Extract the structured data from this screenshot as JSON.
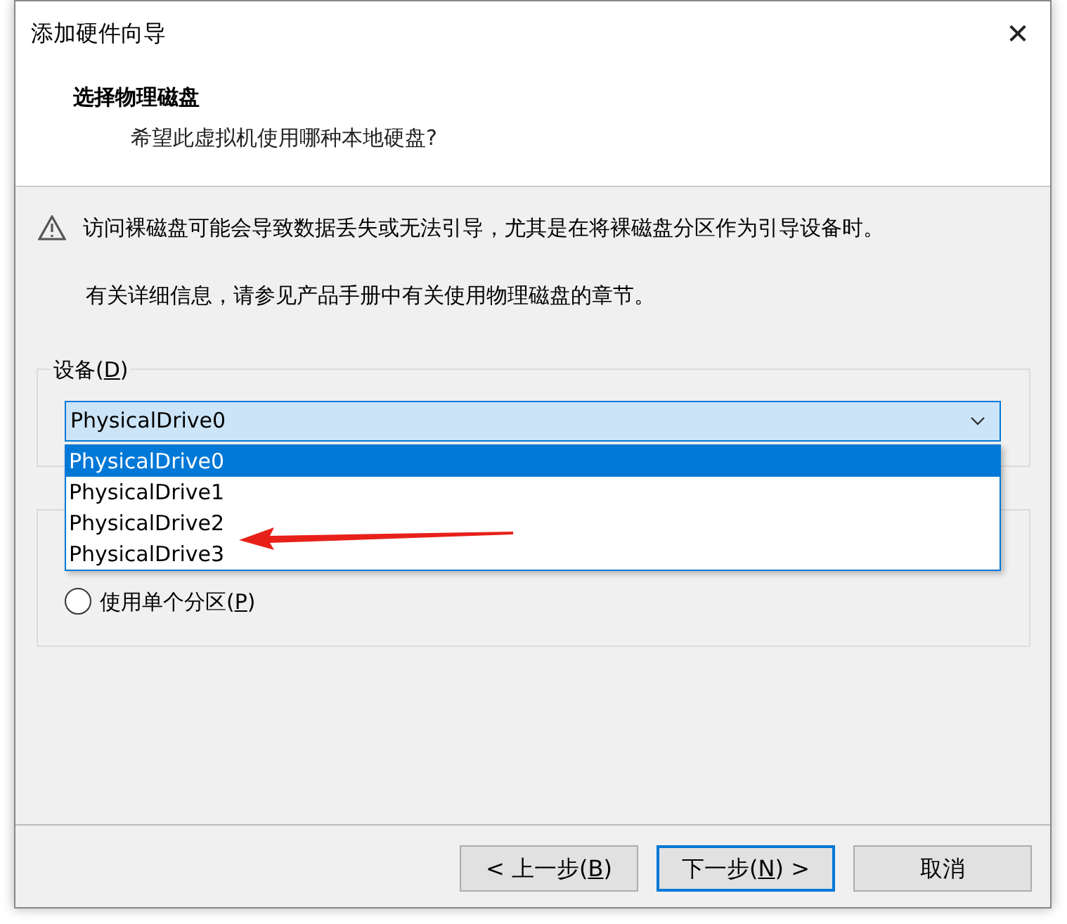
{
  "window": {
    "title": "添加硬件向导",
    "close": "✕"
  },
  "header": {
    "title": "选择物理磁盘",
    "subtitle": "希望此虚拟机使用哪种本地硬盘?"
  },
  "warning": {
    "text": "访问裸磁盘可能会导致数据丢失或无法引导，尤其是在将裸磁盘分区作为引导设备时。",
    "info": "有关详细信息，请参见产品手册中有关使用物理磁盘的章节。"
  },
  "device_group": {
    "label": {
      "before": "设备(",
      "accel": "D",
      "after": ")"
    },
    "value": "PhysicalDrive0",
    "options": [
      {
        "text": "PhysicalDrive0",
        "selected": true
      },
      {
        "text": "PhysicalDrive1",
        "selected": false
      },
      {
        "text": "PhysicalDrive2",
        "selected": false
      },
      {
        "text": "PhysicalDrive3",
        "selected": false
      }
    ]
  },
  "usage_group": {
    "radios": [
      {
        "label": {
          "before": "使用单个分区(",
          "accel": "P",
          "after": ")"
        },
        "checked": false
      }
    ]
  },
  "buttons": [
    {
      "label": {
        "before": "< 上一步(",
        "accel": "B",
        "after": ")"
      },
      "focused": false
    },
    {
      "label": {
        "before": "下一步(",
        "accel": "N",
        "after": ") >"
      },
      "focused": true
    },
    {
      "label": {
        "before": "取消"
      },
      "focused": false
    }
  ]
}
